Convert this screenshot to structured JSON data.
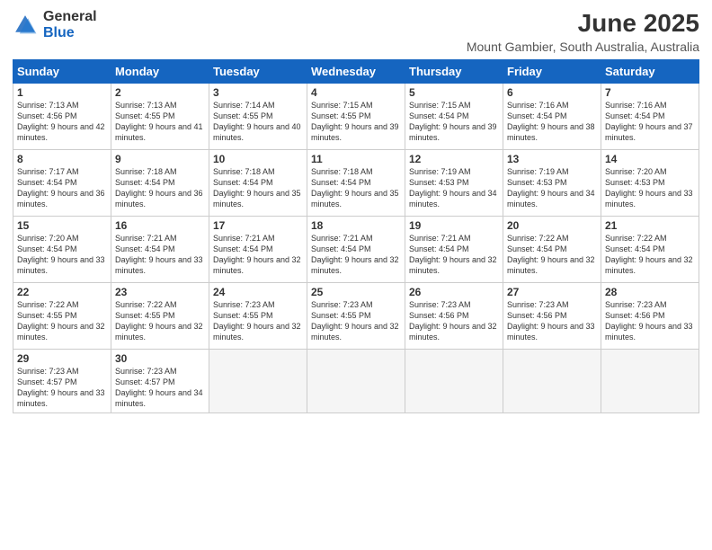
{
  "logo": {
    "general": "General",
    "blue": "Blue"
  },
  "title": "June 2025",
  "subtitle": "Mount Gambier, South Australia, Australia",
  "days_header": [
    "Sunday",
    "Monday",
    "Tuesday",
    "Wednesday",
    "Thursday",
    "Friday",
    "Saturday"
  ],
  "weeks": [
    [
      {
        "num": "1",
        "sunrise": "7:13 AM",
        "sunset": "4:56 PM",
        "daylight": "9 hours and 42 minutes."
      },
      {
        "num": "2",
        "sunrise": "7:13 AM",
        "sunset": "4:55 PM",
        "daylight": "9 hours and 41 minutes."
      },
      {
        "num": "3",
        "sunrise": "7:14 AM",
        "sunset": "4:55 PM",
        "daylight": "9 hours and 40 minutes."
      },
      {
        "num": "4",
        "sunrise": "7:15 AM",
        "sunset": "4:55 PM",
        "daylight": "9 hours and 39 minutes."
      },
      {
        "num": "5",
        "sunrise": "7:15 AM",
        "sunset": "4:54 PM",
        "daylight": "9 hours and 39 minutes."
      },
      {
        "num": "6",
        "sunrise": "7:16 AM",
        "sunset": "4:54 PM",
        "daylight": "9 hours and 38 minutes."
      },
      {
        "num": "7",
        "sunrise": "7:16 AM",
        "sunset": "4:54 PM",
        "daylight": "9 hours and 37 minutes."
      }
    ],
    [
      {
        "num": "8",
        "sunrise": "7:17 AM",
        "sunset": "4:54 PM",
        "daylight": "9 hours and 36 minutes."
      },
      {
        "num": "9",
        "sunrise": "7:18 AM",
        "sunset": "4:54 PM",
        "daylight": "9 hours and 36 minutes."
      },
      {
        "num": "10",
        "sunrise": "7:18 AM",
        "sunset": "4:54 PM",
        "daylight": "9 hours and 35 minutes."
      },
      {
        "num": "11",
        "sunrise": "7:18 AM",
        "sunset": "4:54 PM",
        "daylight": "9 hours and 35 minutes."
      },
      {
        "num": "12",
        "sunrise": "7:19 AM",
        "sunset": "4:53 PM",
        "daylight": "9 hours and 34 minutes."
      },
      {
        "num": "13",
        "sunrise": "7:19 AM",
        "sunset": "4:53 PM",
        "daylight": "9 hours and 34 minutes."
      },
      {
        "num": "14",
        "sunrise": "7:20 AM",
        "sunset": "4:53 PM",
        "daylight": "9 hours and 33 minutes."
      }
    ],
    [
      {
        "num": "15",
        "sunrise": "7:20 AM",
        "sunset": "4:54 PM",
        "daylight": "9 hours and 33 minutes."
      },
      {
        "num": "16",
        "sunrise": "7:21 AM",
        "sunset": "4:54 PM",
        "daylight": "9 hours and 33 minutes."
      },
      {
        "num": "17",
        "sunrise": "7:21 AM",
        "sunset": "4:54 PM",
        "daylight": "9 hours and 32 minutes."
      },
      {
        "num": "18",
        "sunrise": "7:21 AM",
        "sunset": "4:54 PM",
        "daylight": "9 hours and 32 minutes."
      },
      {
        "num": "19",
        "sunrise": "7:21 AM",
        "sunset": "4:54 PM",
        "daylight": "9 hours and 32 minutes."
      },
      {
        "num": "20",
        "sunrise": "7:22 AM",
        "sunset": "4:54 PM",
        "daylight": "9 hours and 32 minutes."
      },
      {
        "num": "21",
        "sunrise": "7:22 AM",
        "sunset": "4:54 PM",
        "daylight": "9 hours and 32 minutes."
      }
    ],
    [
      {
        "num": "22",
        "sunrise": "7:22 AM",
        "sunset": "4:55 PM",
        "daylight": "9 hours and 32 minutes."
      },
      {
        "num": "23",
        "sunrise": "7:22 AM",
        "sunset": "4:55 PM",
        "daylight": "9 hours and 32 minutes."
      },
      {
        "num": "24",
        "sunrise": "7:23 AM",
        "sunset": "4:55 PM",
        "daylight": "9 hours and 32 minutes."
      },
      {
        "num": "25",
        "sunrise": "7:23 AM",
        "sunset": "4:55 PM",
        "daylight": "9 hours and 32 minutes."
      },
      {
        "num": "26",
        "sunrise": "7:23 AM",
        "sunset": "4:56 PM",
        "daylight": "9 hours and 32 minutes."
      },
      {
        "num": "27",
        "sunrise": "7:23 AM",
        "sunset": "4:56 PM",
        "daylight": "9 hours and 33 minutes."
      },
      {
        "num": "28",
        "sunrise": "7:23 AM",
        "sunset": "4:56 PM",
        "daylight": "9 hours and 33 minutes."
      }
    ],
    [
      {
        "num": "29",
        "sunrise": "7:23 AM",
        "sunset": "4:57 PM",
        "daylight": "9 hours and 33 minutes."
      },
      {
        "num": "30",
        "sunrise": "7:23 AM",
        "sunset": "4:57 PM",
        "daylight": "9 hours and 34 minutes."
      },
      null,
      null,
      null,
      null,
      null
    ]
  ]
}
